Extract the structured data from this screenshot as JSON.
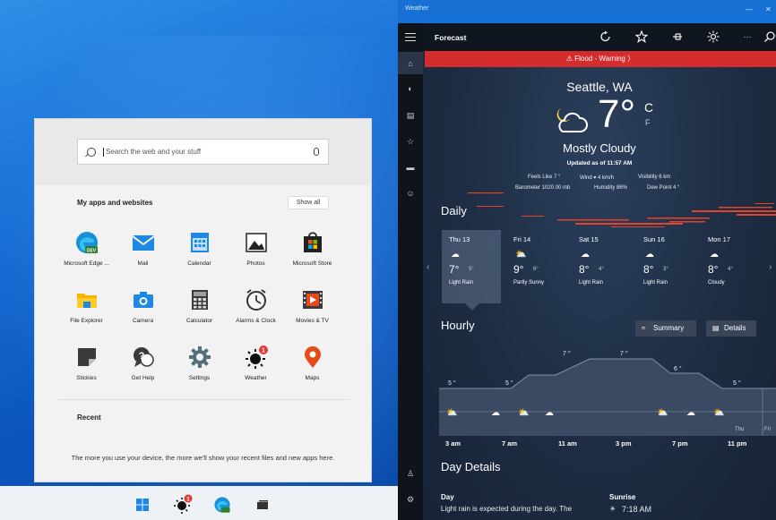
{
  "start_menu": {
    "search_placeholder": "Search the web and your stuff",
    "apps_title": "My apps and websites",
    "show_all": "Show all",
    "apps": [
      {
        "label": "Microsoft Edge ...",
        "icon": "edge-dev-icon"
      },
      {
        "label": "Mail",
        "icon": "mail-icon"
      },
      {
        "label": "Calendar",
        "icon": "calendar-icon"
      },
      {
        "label": "Photos",
        "icon": "photos-icon"
      },
      {
        "label": "Microsoft Store",
        "icon": "store-icon"
      },
      {
        "label": "File Explorer",
        "icon": "folder-icon"
      },
      {
        "label": "Camera",
        "icon": "camera-icon"
      },
      {
        "label": "Calculator",
        "icon": "calculator-icon"
      },
      {
        "label": "Alarms & Clock",
        "icon": "clock-icon"
      },
      {
        "label": "Movies & TV",
        "icon": "movies-icon"
      },
      {
        "label": "Stickies",
        "icon": "stickies-icon"
      },
      {
        "label": "Get Help",
        "icon": "help-icon"
      },
      {
        "label": "Settings",
        "icon": "gear-icon"
      },
      {
        "label": "Weather",
        "icon": "weather-icon",
        "badge": "1"
      },
      {
        "label": "Maps",
        "icon": "maps-icon"
      }
    ],
    "recent_title": "Recent",
    "recent_text": "The more you use your device, the more we'll show your recent files and new apps here."
  },
  "taskbar": {
    "items": [
      "windows-start-icon",
      "weather-icon",
      "edge-dev-icon",
      "task-view-icon"
    ],
    "weather_badge": "1"
  },
  "weather": {
    "window_title": "Weather",
    "toolbar_title": "Forecast",
    "warning": "⚠  Flood - Warning  〉",
    "city": "Seattle, WA",
    "temperature": "7°",
    "unit_c": "C",
    "unit_f": "F",
    "condition": "Mostly Cloudy",
    "updated": "Updated as of 11:57 AM",
    "stats_row1": {
      "feels": "Feels Like  7 °",
      "wind": "Wind  ▾ 4 km/h",
      "visibility": "Visibility  6 km"
    },
    "stats_row2": {
      "barometer": "Barometer  1020.00 mb",
      "humidity": "Humidity  86%",
      "dew": "Dew Point  4 °"
    },
    "daily_title": "Daily",
    "daily": [
      {
        "day": "Thu 13",
        "icon": "☁",
        "hi": "7°",
        "lo": "5°",
        "cond": "Light Rain"
      },
      {
        "day": "Fri 14",
        "icon": "⛅",
        "hi": "9°",
        "lo": "6°",
        "cond": "Partly Sunny"
      },
      {
        "day": "Sat 15",
        "icon": "☁",
        "hi": "8°",
        "lo": "4°",
        "cond": "Light Rain"
      },
      {
        "day": "Sun 16",
        "icon": "☁",
        "hi": "8°",
        "lo": "3°",
        "cond": "Light Rain"
      },
      {
        "day": "Mon 17",
        "icon": "☁",
        "hi": "8°",
        "lo": "4°",
        "cond": "Cloudy"
      }
    ],
    "hourly_title": "Hourly",
    "summary_btn": "Summary",
    "details_btn": "Details",
    "hourly_labels": [
      "5 °",
      "5 °",
      "7 °",
      "7 °",
      "6 °",
      "5 °"
    ],
    "hourly_times": [
      "3 am",
      "7 am",
      "11 am",
      "3 pm",
      "7 pm",
      "11 pm"
    ],
    "hourly_day_labels": [
      "Thu",
      "Fri"
    ],
    "day_details_title": "Day Details",
    "day_label": "Day",
    "day_text": "Light rain is expected during the day. The",
    "sunrise_label": "Sunrise",
    "sunrise_value": "7:18 AM",
    "nav_icons": [
      "home-icon",
      "forecast-icon",
      "maps-icon",
      "historical-icon",
      "news-icon",
      "favorites-icon",
      "feedback-icon",
      "user-icon",
      "settings-icon"
    ]
  }
}
